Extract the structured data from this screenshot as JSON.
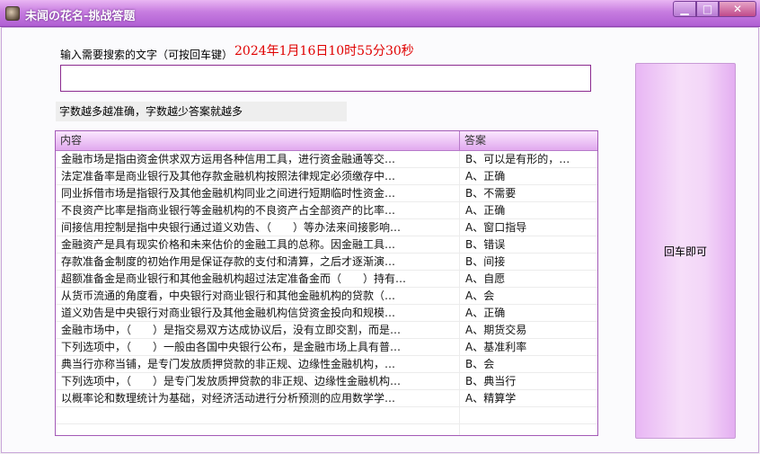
{
  "window": {
    "title": "未闻の花名-挑战答题",
    "min_glyph": "▁",
    "max_glyph": "□",
    "close_glyph": "✕"
  },
  "search": {
    "label": "输入需要搜索的文字（可按回车键）",
    "value": "",
    "placeholder": ""
  },
  "clock": "2024年1月16日10时55分30秒",
  "hint": "字数越多越准确，字数越少答案就越多",
  "table": {
    "columns": [
      "内容",
      "答案"
    ],
    "rows": [
      {
        "content": "金融市场是指由资金供求双方运用各种信用工具，进行资金融通等交…",
        "answer": "B、可以是有形的，…"
      },
      {
        "content": "法定准备率是商业银行及其他存款金融机构按照法律规定必须缴存中…",
        "answer": "A、正确"
      },
      {
        "content": "同业拆借市场是指银行及其他金融机构同业之间进行短期临时性资金…",
        "answer": "B、不需要"
      },
      {
        "content": "不良资产比率是指商业银行等金融机构的不良资产占全部资产的比率…",
        "answer": "A、正确"
      },
      {
        "content": "间接信用控制是指中央银行通过道义劝告、（　　）等办法来间接影响…",
        "answer": "A、窗口指导"
      },
      {
        "content": "金融资产是具有现实价格和未来估价的金融工具的总称。因金融工具…",
        "answer": "B、错误"
      },
      {
        "content": "存款准备金制度的初始作用是保证存款的支付和清算，之后才逐渐演…",
        "answer": "B、间接"
      },
      {
        "content": "超额准备金是商业银行和其他金融机构超过法定准备金而（　　）持有…",
        "answer": "A、自愿"
      },
      {
        "content": "从货币流通的角度看，中央银行对商业银行和其他金融机构的贷款（…",
        "answer": "A、会"
      },
      {
        "content": "道义劝告是中央银行对商业银行及其他金融机构信贷资金投向和规模…",
        "answer": "A、正确"
      },
      {
        "content": "金融市场中，（　　）是指交易双方达成协议后，没有立即交割，而是…",
        "answer": "A、期货交易"
      },
      {
        "content": "下列选项中，（　　）一般由各国中央银行公布，是金融市场上具有普…",
        "answer": "A、基准利率"
      },
      {
        "content": "典当行亦称当铺，是专门发放质押贷款的非正规、边缘性金融机构，…",
        "answer": "B、会"
      },
      {
        "content": "下列选项中，（　　）是专门发放质押贷款的非正规、边缘性金融机构…",
        "answer": "B、典当行"
      },
      {
        "content": "以概率论和数理统计为基础，对经济活动进行分析预测的应用数学学…",
        "answer": "A、精算学"
      }
    ]
  },
  "enter_button": "回车即可",
  "colors": {
    "accent": "#b05fd3",
    "clock_text": "#e00000",
    "border": "#8b2a8f"
  }
}
